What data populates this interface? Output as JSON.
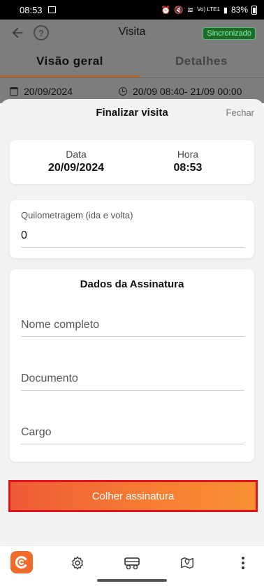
{
  "status_bar": {
    "time": "08:53",
    "battery": "83%",
    "network": "Vo) LTE1"
  },
  "header": {
    "title": "Visita",
    "sync_status": "Sincronizado"
  },
  "tabs": [
    {
      "label": "Visão geral",
      "active": true
    },
    {
      "label": "Detalhes",
      "active": false
    }
  ],
  "visit_info": {
    "date": "20/09/2024",
    "time_range": "20/09 08:40- 21/09 00:00"
  },
  "sheet": {
    "title": "Finalizar visita",
    "close_label": "Fechar",
    "date_label": "Data",
    "date_value": "20/09/2024",
    "hour_label": "Hora",
    "hour_value": "08:53",
    "mileage_label": "Quilometragem (ida e volta)",
    "mileage_value": "0",
    "signature_title": "Dados da Assinatura",
    "fields": [
      {
        "placeholder": "Nome completo"
      },
      {
        "placeholder": "Documento"
      },
      {
        "placeholder": "Cargo"
      }
    ],
    "collect_button": "Colher assinatura"
  },
  "bottom_nav": [
    {
      "icon": "app-logo-icon"
    },
    {
      "icon": "gear-icon"
    },
    {
      "icon": "vehicle-icon"
    },
    {
      "icon": "map-pin-icon"
    },
    {
      "icon": "more-vertical-icon"
    }
  ],
  "colors": {
    "accent_orange": "#f26b2a",
    "gradient_start": "#ee5a36",
    "gradient_end": "#f89033",
    "highlight_border": "#e0151e",
    "sync_badge_bg": "#1c6b2d"
  }
}
